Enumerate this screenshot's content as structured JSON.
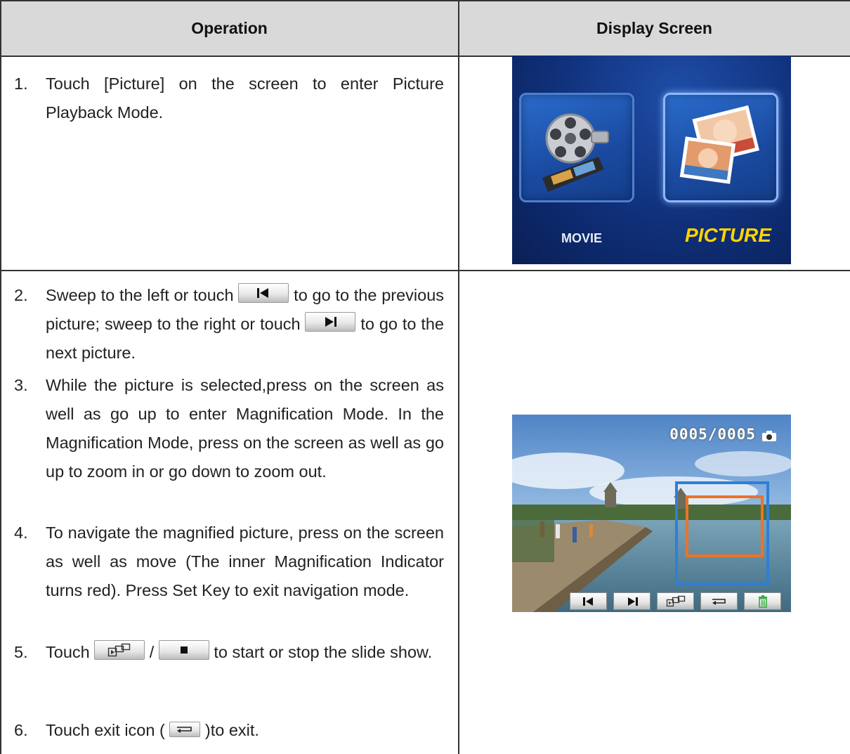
{
  "table": {
    "headers": [
      "Operation",
      "Display Screen"
    ]
  },
  "steps": [
    {
      "num": "1.",
      "text": "Touch [Picture] on the screen to enter Picture Playback Mode."
    },
    {
      "num": "2.",
      "pre": "Sweep to the left or touch",
      "mid": "to go to the previous picture; sweep to the right or touch",
      "post": "to go to the next picture."
    },
    {
      "num": "3.",
      "text": "While the picture is selected,press on the screen as well as go up to enter Magnification Mode. In the Magnification Mode, press on the screen as well as go up to zoom in or go down to zoom out."
    },
    {
      "num": "4.",
      "text": "To navigate the magnified picture, press on the screen as well as move (The inner Magnification Indicator turns red). Press Set Key to exit navigation mode."
    },
    {
      "num": "5.",
      "pre": "Touch",
      "sep": "/",
      "post": "to start or stop the slide show."
    },
    {
      "num": "6.",
      "pre": "Touch exit icon (",
      "post": ")to exit."
    }
  ],
  "menu_screen": {
    "movie_label": "MOVIE",
    "picture_label": "PICTURE",
    "selected": "PICTURE",
    "colors": {
      "background": "#0f2f78",
      "picture_label": "#ffd400",
      "movie_label": "#e6ecf5"
    }
  },
  "playback_screen": {
    "counter": "0005/0005",
    "toolbar_icons": [
      "previous-icon",
      "next-icon",
      "slideshow-icon",
      "exit-icon",
      "delete-icon"
    ],
    "colors": {
      "outer_indicator": "#2e7fd6",
      "inner_indicator": "#e8742a",
      "delete": "#2fae3a"
    }
  }
}
